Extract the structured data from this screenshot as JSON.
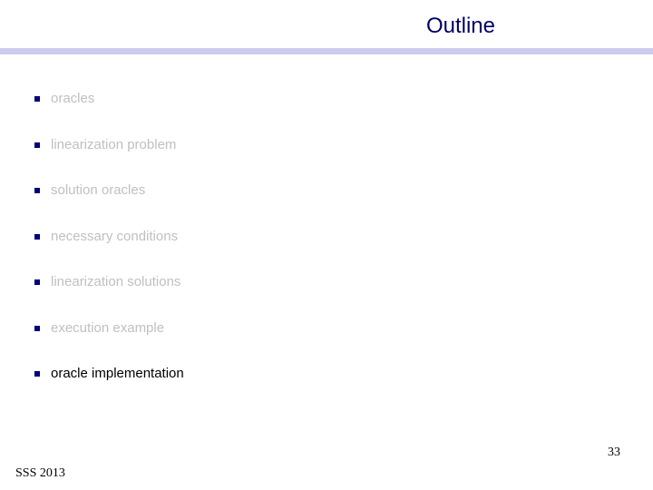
{
  "slide": {
    "title": "Outline",
    "bullets": [
      {
        "text": "oracles",
        "active": false
      },
      {
        "text": "linearization problem",
        "active": false
      },
      {
        "text": "solution oracles",
        "active": false
      },
      {
        "text": "necessary conditions",
        "active": false
      },
      {
        "text": "linearization solutions",
        "active": false
      },
      {
        "text": "execution example",
        "active": false
      },
      {
        "text": "oracle implementation",
        "active": true
      }
    ],
    "page_number": "33",
    "footer": "SSS 2013"
  },
  "colors": {
    "title": "#000066",
    "title_bar": "#ccccf0",
    "bullet_mark": "#000080",
    "inactive_text": "#c0c0c0",
    "active_text": "#000000"
  }
}
